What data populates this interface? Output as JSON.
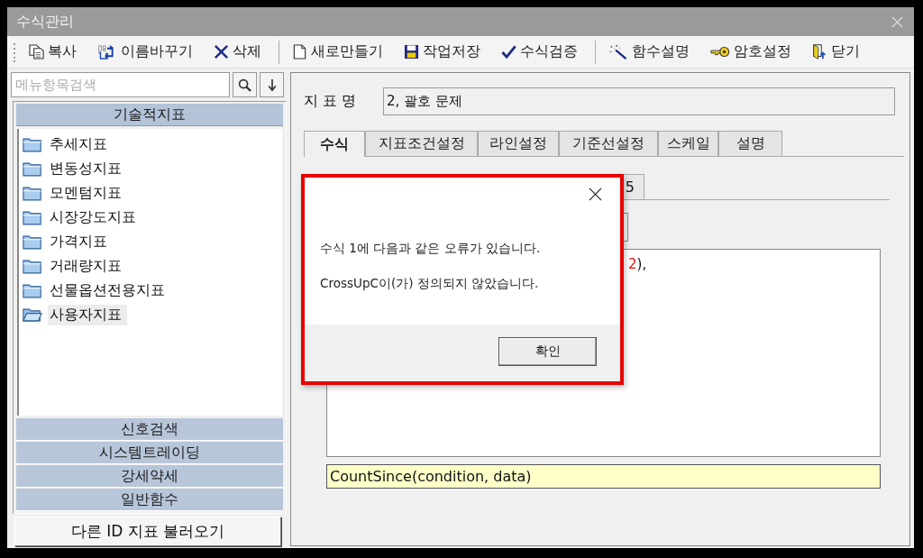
{
  "window": {
    "title": "수식관리"
  },
  "toolbar": {
    "groups": [
      [
        {
          "label": "복사"
        },
        {
          "label": "이름바꾸기"
        },
        {
          "label": "삭제"
        }
      ],
      [
        {
          "label": "새로만들기"
        },
        {
          "label": "작업저장"
        },
        {
          "label": "수식검증"
        }
      ],
      [
        {
          "label": "함수설명"
        },
        {
          "label": "암호설정"
        },
        {
          "label": "닫기"
        }
      ]
    ]
  },
  "sidebar": {
    "search": {
      "placeholder": "메뉴항목검색"
    },
    "sections": [
      {
        "label": "기술적지표",
        "expanded": true,
        "items": [
          {
            "label": "추세지표",
            "selected": false
          },
          {
            "label": "변동성지표",
            "selected": false
          },
          {
            "label": "모멘텀지표",
            "selected": false
          },
          {
            "label": "시장강도지표",
            "selected": false
          },
          {
            "label": "가격지표",
            "selected": false
          },
          {
            "label": "거래량지표",
            "selected": false
          },
          {
            "label": "선물옵션전용지표",
            "selected": false
          },
          {
            "label": "사용자지표",
            "selected": true
          }
        ]
      },
      {
        "label": "신호검색",
        "expanded": false
      },
      {
        "label": "시스템트레이딩",
        "expanded": false
      },
      {
        "label": "강세약세",
        "expanded": false
      },
      {
        "label": "일반함수",
        "expanded": false
      }
    ],
    "load_button": "다른 ID 지표 불러오기"
  },
  "indicator_name": {
    "label": "지 표 명",
    "value": "2, 괄호 문제"
  },
  "tabs": [
    {
      "label": "수식",
      "selected": true
    },
    {
      "label": "지표조건설정",
      "selected": false
    },
    {
      "label": "라인설정",
      "selected": false
    },
    {
      "label": "기준선설정",
      "selected": false
    },
    {
      "label": "스케일",
      "selected": false
    },
    {
      "label": "설명",
      "selected": false
    }
  ],
  "sub_tabs": [
    {
      "label": "5"
    }
  ],
  "editor": {
    "tokens": [
      {
        "text": "2",
        "kind": "number"
      },
      {
        "text": "),",
        "kind": "plain"
      }
    ]
  },
  "hint": "CountSince(condition, data)",
  "dialog": {
    "lines": [
      "수식 1에 다음과 같은 오류가 있습니다.",
      "CrossUpC이(가) 정의되지 않았습니다."
    ],
    "button": "확인"
  }
}
